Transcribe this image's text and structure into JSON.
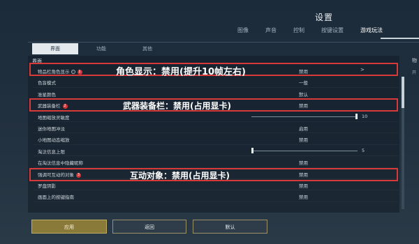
{
  "title": "设置",
  "nav": [
    "图像",
    "声音",
    "控制",
    "按键设置",
    "游戏玩法"
  ],
  "subtabs": [
    "界面",
    "功能",
    "其他"
  ],
  "section": "界面",
  "rows": [
    {
      "label": "物品栏角色显示",
      "value": "禁用",
      "info": "i",
      "badge": "1",
      "arrow": ">"
    },
    {
      "label": "色盲模式",
      "value": "一般"
    },
    {
      "label": "准星颜色",
      "value": "默认"
    },
    {
      "label": "武器装备栏",
      "value": "禁用",
      "badge": "2"
    },
    {
      "label": "地图缩放灵敏度",
      "slider_value": "10",
      "slider_level": 1.0
    },
    {
      "label": "迷你地图冲淡",
      "value": "启用"
    },
    {
      "label": "小地图动态缩放",
      "value": "禁用"
    },
    {
      "label": "淘汰信息上限",
      "slider_value": "5",
      "slider_level": 0.0
    },
    {
      "label": "在淘汰信息中隐藏昵称",
      "value": "禁用"
    },
    {
      "label": "强调可互动的对象",
      "value": "禁用",
      "badge": "3"
    },
    {
      "label": "罗盘阴影",
      "value": "禁用"
    },
    {
      "label": "画面上的按键指南",
      "value": "禁用"
    }
  ],
  "annotations": [
    "角色显示：禁用(提升10帧左右)",
    "武器装备栏：禁用(占用显卡)",
    "互动对象：禁用(占用显卡)"
  ],
  "side": {
    "label1": "物",
    "label2": "开"
  },
  "buttons": {
    "apply": "应用",
    "back": "返回",
    "default": "默认"
  },
  "colors": {
    "annotation": "#d83a3a",
    "apply_button": "#8a7a3a"
  }
}
